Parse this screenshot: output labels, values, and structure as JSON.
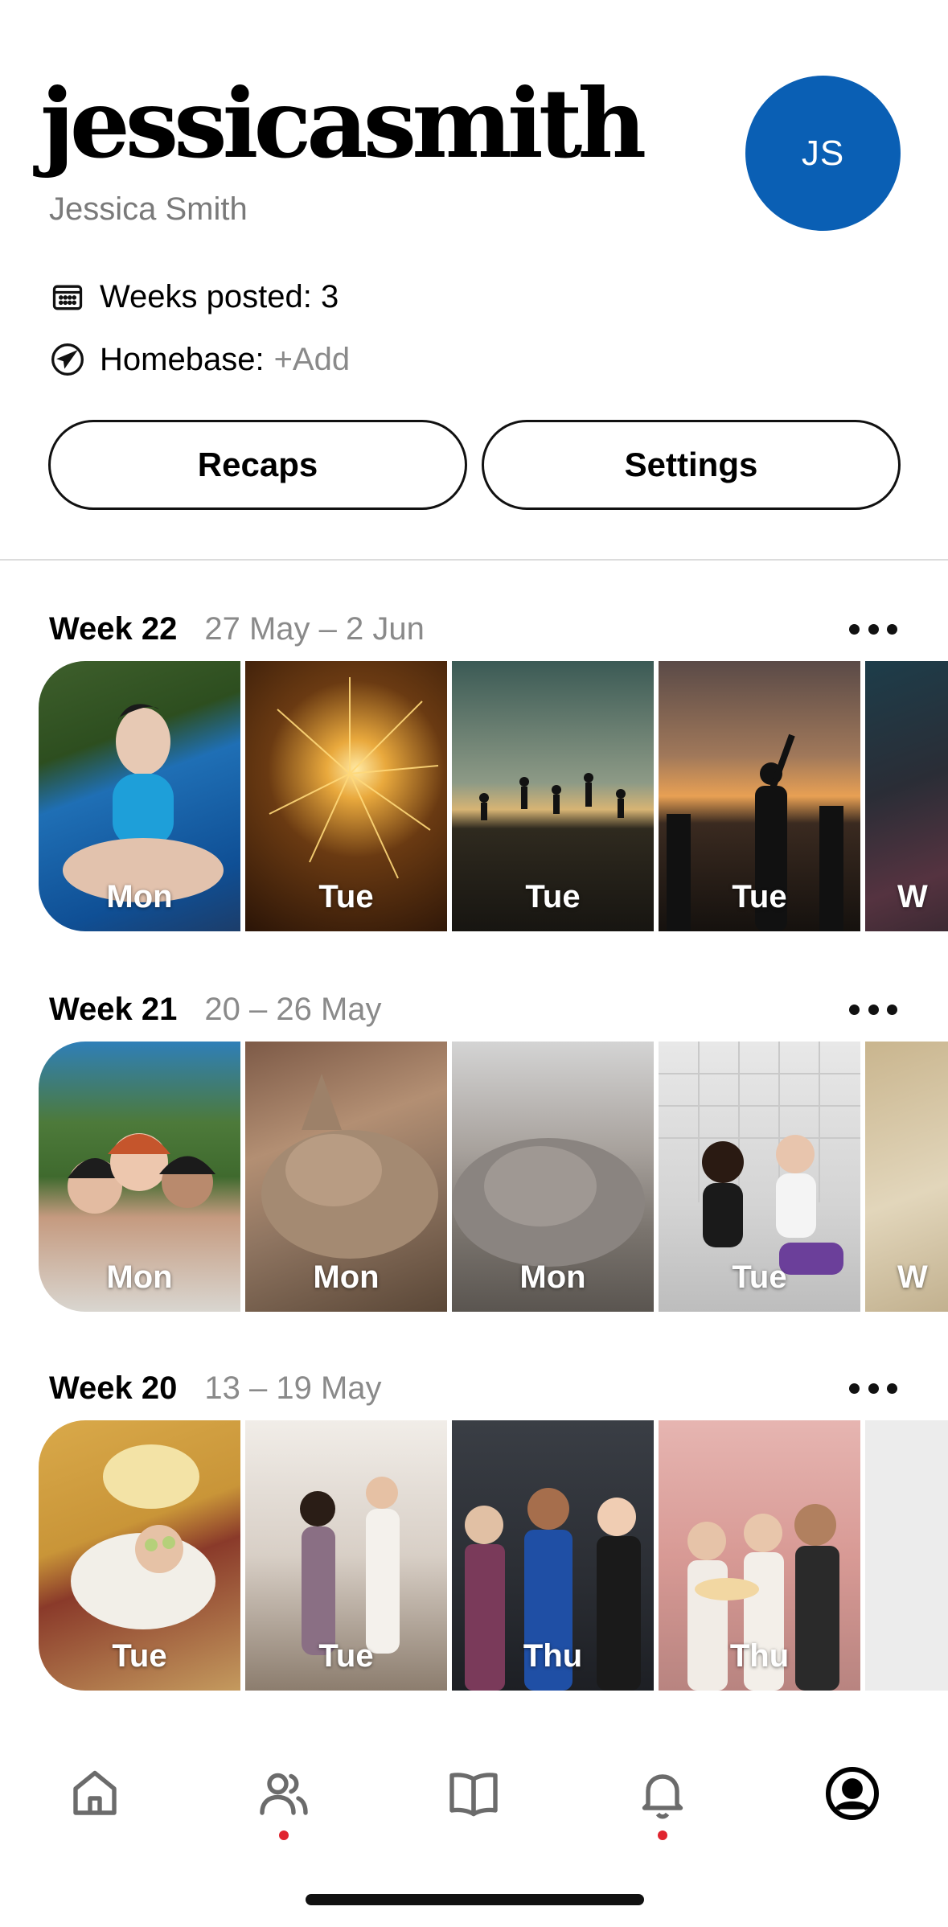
{
  "profile": {
    "username": "jessicasmith",
    "full_name": "Jessica Smith",
    "initials": "JS",
    "avatar_color": "#0a5fb4",
    "weeks_posted": "Weeks posted: 3",
    "homebase_label": "Homebase:",
    "homebase_action": "+Add"
  },
  "buttons": {
    "recaps": "Recaps",
    "settings": "Settings"
  },
  "weeks": [
    {
      "title": "Week 22",
      "range": "27 May – 2 Jun",
      "tiles": [
        {
          "day": "Mon",
          "scene": "yoga on mat"
        },
        {
          "day": "Tue",
          "scene": "sparkler"
        },
        {
          "day": "Tue",
          "scene": "beach jump silhouettes"
        },
        {
          "day": "Tue",
          "scene": "sunset crowd"
        },
        {
          "day": "W",
          "scene": "party"
        }
      ]
    },
    {
      "title": "Week 21",
      "range": "20 – 26 May",
      "tiles": [
        {
          "day": "Mon",
          "scene": "friends selfie"
        },
        {
          "day": "Mon",
          "scene": "sleeping kitten"
        },
        {
          "day": "Mon",
          "scene": "sleeping cat"
        },
        {
          "day": "Tue",
          "scene": "friends party"
        },
        {
          "day": "W",
          "scene": "blurred"
        }
      ]
    },
    {
      "title": "Week 20",
      "range": "13 – 19 May",
      "tiles": [
        {
          "day": "Tue",
          "scene": "spa cucumbers"
        },
        {
          "day": "Tue",
          "scene": "dancing friends"
        },
        {
          "day": "Thu",
          "scene": "toast"
        },
        {
          "day": "Thu",
          "scene": "birthday cake"
        },
        {
          "day": "",
          "scene": "empty"
        }
      ]
    }
  ],
  "tabbar": {
    "items": [
      {
        "name": "home-icon",
        "badge": false
      },
      {
        "name": "friends-icon",
        "badge": true
      },
      {
        "name": "book-icon",
        "badge": false
      },
      {
        "name": "bell-icon",
        "badge": true
      },
      {
        "name": "profile-icon",
        "badge": false,
        "active": true
      }
    ],
    "badge_color": "#e0252f"
  }
}
